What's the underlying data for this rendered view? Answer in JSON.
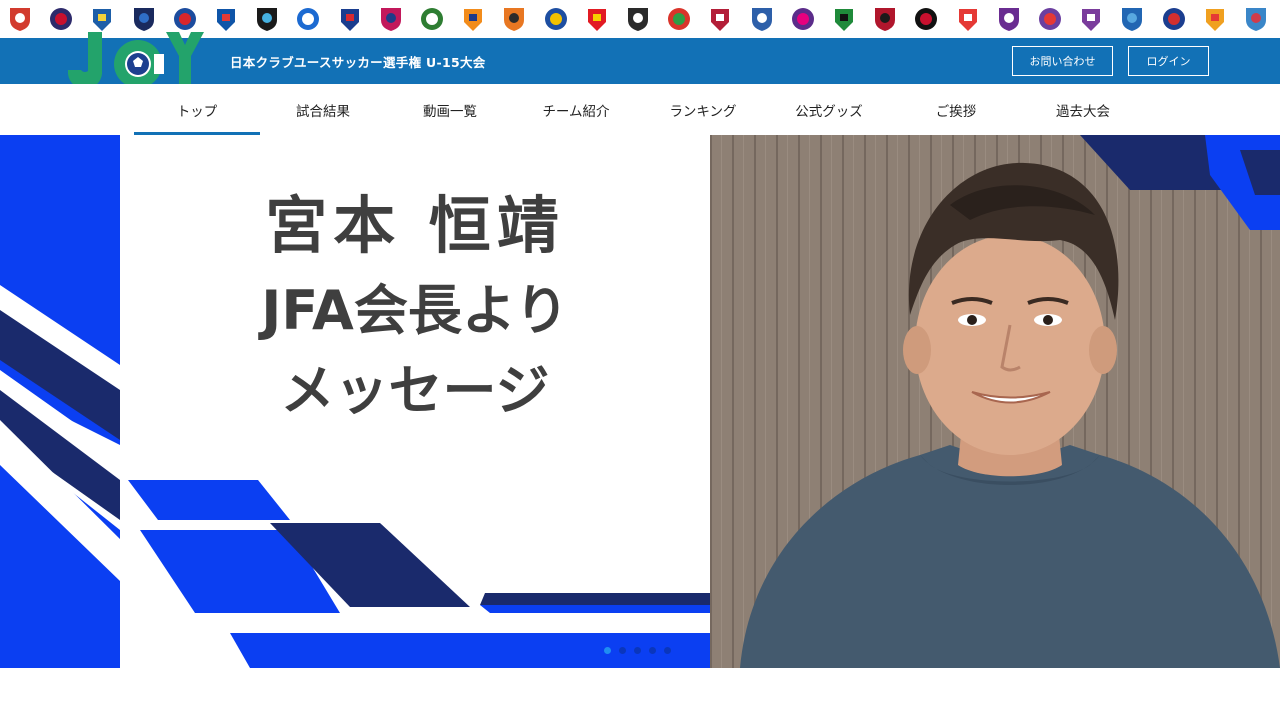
{
  "club_strip": {
    "crests": [
      {
        "name": "club-crest-1",
        "color": "#d23b2e",
        "accent": "#ffffff"
      },
      {
        "name": "club-crest-2",
        "color": "#2d2a6b",
        "accent": "#c8102e"
      },
      {
        "name": "club-crest-3",
        "color": "#1d5ea8",
        "accent": "#f3d23a"
      },
      {
        "name": "club-crest-4",
        "color": "#1a2a5e",
        "accent": "#2f6ec7"
      },
      {
        "name": "club-crest-5",
        "color": "#1c4c9e",
        "accent": "#d9262b"
      },
      {
        "name": "club-crest-6",
        "color": "#0f55a8",
        "accent": "#e53935"
      },
      {
        "name": "club-crest-7",
        "color": "#1a1a1a",
        "accent": "#46b1e1"
      },
      {
        "name": "club-crest-8",
        "color": "#1c6ad1",
        "accent": "#ffffff"
      },
      {
        "name": "club-crest-9",
        "color": "#1a3d8f",
        "accent": "#d92a30"
      },
      {
        "name": "club-crest-10",
        "color": "#c2185b",
        "accent": "#1f3c88"
      },
      {
        "name": "club-crest-11",
        "color": "#2e7d32",
        "accent": "#ffffff"
      },
      {
        "name": "club-crest-12",
        "color": "#f28c1b",
        "accent": "#1e3a8a"
      },
      {
        "name": "club-crest-13",
        "color": "#e87722",
        "accent": "#2b2b2b"
      },
      {
        "name": "club-crest-14",
        "color": "#1d4ea1",
        "accent": "#f2c100"
      },
      {
        "name": "club-crest-15",
        "color": "#e21b23",
        "accent": "#f6d000"
      },
      {
        "name": "club-crest-16",
        "color": "#2a2a2a",
        "accent": "#ffffff"
      },
      {
        "name": "club-crest-17",
        "color": "#d9342b",
        "accent": "#2e9e46"
      },
      {
        "name": "club-crest-18",
        "color": "#b31e38",
        "accent": "#ffffff"
      },
      {
        "name": "club-crest-19",
        "color": "#2d5fa9",
        "accent": "#ffffff"
      },
      {
        "name": "club-crest-20",
        "color": "#5b2c8a",
        "accent": "#e6007e"
      },
      {
        "name": "club-crest-21",
        "color": "#1f8a3a",
        "accent": "#111111"
      },
      {
        "name": "club-crest-22",
        "color": "#b0162c",
        "accent": "#1a1a1a"
      },
      {
        "name": "club-crest-23",
        "color": "#111111",
        "accent": "#c8102e"
      },
      {
        "name": "club-crest-24",
        "color": "#e53935",
        "accent": "#ffffff"
      },
      {
        "name": "club-crest-25",
        "color": "#6a2c91",
        "accent": "#ffffff"
      },
      {
        "name": "club-crest-26",
        "color": "#6b3fa0",
        "accent": "#e53935"
      },
      {
        "name": "club-crest-27",
        "color": "#7a3c9c",
        "accent": "#ffffff"
      },
      {
        "name": "club-crest-28",
        "color": "#2166b3",
        "accent": "#58a8e0"
      },
      {
        "name": "club-crest-29",
        "color": "#1b3e8f",
        "accent": "#d32f2f"
      },
      {
        "name": "club-crest-30",
        "color": "#f0a020",
        "accent": "#e53935"
      },
      {
        "name": "club-crest-31",
        "color": "#3a86c8",
        "accent": "#d23b4a"
      }
    ]
  },
  "header": {
    "logo_text": "JCY",
    "tournament_title": "日本クラブユースサッカー選手権 U-15大会",
    "contact_label": "お問い合わせ",
    "login_label": "ログイン",
    "bar_color": "#1271b6"
  },
  "nav": {
    "items": [
      {
        "label": "トップ",
        "active": true
      },
      {
        "label": "試合結果",
        "active": false
      },
      {
        "label": "動画一覧",
        "active": false
      },
      {
        "label": "チーム紹介",
        "active": false
      },
      {
        "label": "ランキング",
        "active": false
      },
      {
        "label": "公式グッズ",
        "active": false
      },
      {
        "label": "ご挨拶",
        "active": false
      },
      {
        "label": "過去大会",
        "active": false
      }
    ]
  },
  "hero": {
    "line1": "宮本 恒靖",
    "line2": "JFA会長より",
    "line3": "メッセージ",
    "colors": {
      "blue": "#0b3ff2",
      "navy": "#1a2a6c",
      "text": "#3f3f3f",
      "wall": "#8b7d70"
    },
    "slide_count": 5,
    "active_slide": 1
  }
}
